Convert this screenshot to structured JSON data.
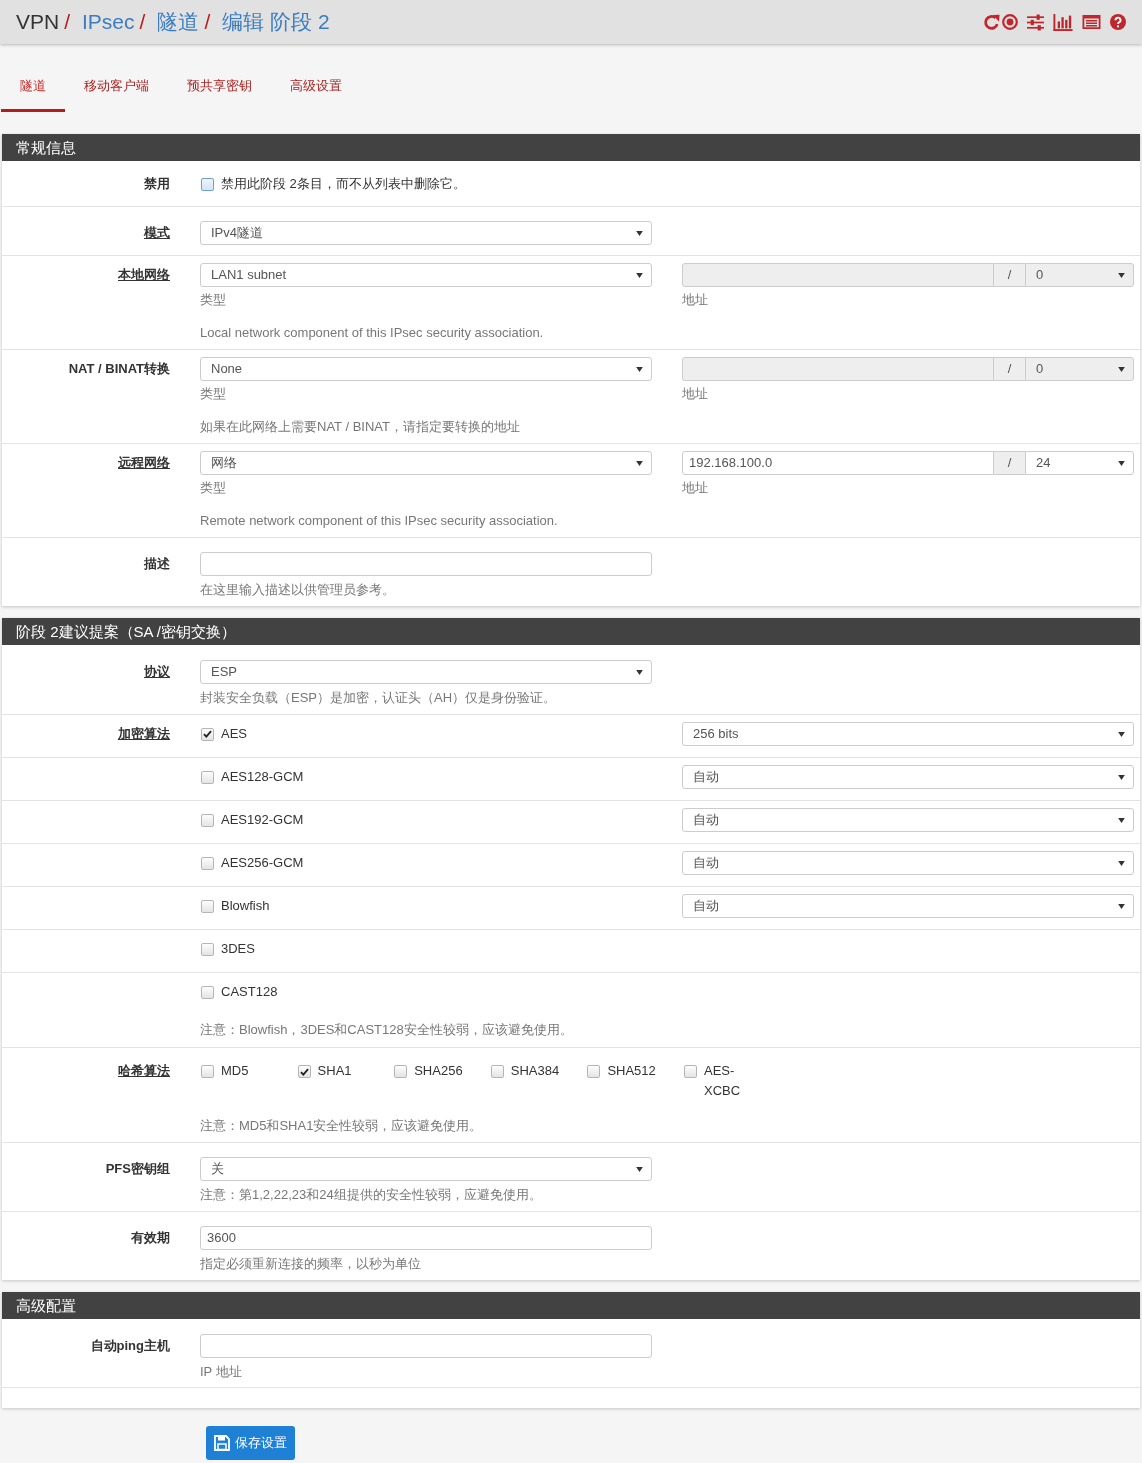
{
  "header": {
    "breadcrumb": [
      {
        "text": "VPN",
        "kind": "plain",
        "separator": "/"
      },
      {
        "text": "IPsec",
        "kind": "link",
        "separator": "/"
      },
      {
        "text": "隧道",
        "kind": "link",
        "separator": "/"
      },
      {
        "text": "编辑 阶段 2",
        "kind": "link"
      }
    ]
  },
  "tabs": [
    {
      "label": "隧道",
      "selected": true
    },
    {
      "label": "移动客户端",
      "selected": false
    },
    {
      "label": "预共享密钥",
      "selected": false
    },
    {
      "label": "高级设置",
      "selected": false
    }
  ],
  "sections": [
    {
      "title": "常规信息",
      "rows": [
        {
          "kind": "checkbox",
          "label": "禁用",
          "required": false,
          "checkbox": {
            "text": "禁用此阶段 2条目，而不从列表中删除它。",
            "checked": false,
            "focused": true
          }
        },
        {
          "kind": "select",
          "label": "模式",
          "required": true,
          "select": {
            "value": "IPv4隧道"
          }
        },
        {
          "kind": "network",
          "label": "本地网络",
          "required": true,
          "type": {
            "value": "LAN1 subnet",
            "caption": "类型"
          },
          "address": {
            "disabled": true,
            "separator": "/",
            "mask": "0",
            "caption": "地址"
          },
          "help": "Local network component of this IPsec security association."
        },
        {
          "kind": "network",
          "label": "NAT / BINAT转换",
          "required": false,
          "type": {
            "value": "None",
            "caption": "类型"
          },
          "address": {
            "disabled": true,
            "separator": "/",
            "mask": "0",
            "caption": "地址"
          },
          "help": "如果在此网络上需要NAT / BINAT，请指定要转换的地址"
        },
        {
          "kind": "network",
          "label": "远程网络",
          "required": true,
          "type": {
            "value": "网络",
            "caption": "类型"
          },
          "address": {
            "value": "192.168.100.0",
            "disabled": false,
            "separator": "/",
            "mask": "24",
            "caption": "地址"
          },
          "help": "Remote network component of this IPsec security association."
        },
        {
          "kind": "text",
          "label": "描述",
          "required": false,
          "help": "在这里输入描述以供管理员参考。"
        }
      ]
    },
    {
      "title": "阶段 2建议提案（SA /密钥交换）",
      "rows": [
        {
          "kind": "select",
          "label": "协议",
          "required": true,
          "select": {
            "value": "ESP"
          },
          "help": "封装安全负载（ESP）是加密，认证头（AH）仅是身份验证。"
        },
        {
          "kind": "algorithms",
          "label": "加密算法",
          "required": true,
          "algorithms": [
            {
              "name": "AES",
              "checked": true,
              "key_length": "256 bits"
            },
            {
              "name": "AES128-GCM",
              "checked": false,
              "key_length": "自动"
            },
            {
              "name": "AES192-GCM",
              "checked": false,
              "key_length": "自动"
            },
            {
              "name": "AES256-GCM",
              "checked": false,
              "key_length": "自动"
            },
            {
              "name": "Blowfish",
              "checked": false,
              "key_length": "自动"
            },
            {
              "name": "3DES",
              "checked": false
            },
            {
              "name": "CAST128",
              "checked": false
            }
          ],
          "help": "注意：Blowfish，3DES和CAST128安全性较弱，应该避免使用。"
        },
        {
          "kind": "checkgroup",
          "label": "哈希算法",
          "required": true,
          "options": [
            {
              "name": "MD5",
              "checked": false
            },
            {
              "name": "SHA1",
              "checked": true
            },
            {
              "name": "SHA256",
              "checked": false
            },
            {
              "name": "SHA384",
              "checked": false
            },
            {
              "name": "SHA512",
              "checked": false
            },
            {
              "name": "AES-XCBC",
              "checked": false
            }
          ],
          "help": "注意：MD5和SHA1安全性较弱，应该避免使用。"
        },
        {
          "kind": "select",
          "label": "PFS密钥组",
          "required": false,
          "select": {
            "value": "关"
          },
          "help": "注意：第1,2,22,23和24组提供的安全性较弱，应避免使用。"
        },
        {
          "kind": "text",
          "label": "有效期",
          "required": false,
          "value": "3600",
          "help": "指定必须重新连接的频率，以秒为单位"
        }
      ]
    },
    {
      "title": "高级配置",
      "rows": [
        {
          "kind": "text",
          "label": "自动ping主机",
          "required": false,
          "help": "IP 地址"
        }
      ]
    }
  ],
  "save_button": {
    "label": "保存设置"
  }
}
